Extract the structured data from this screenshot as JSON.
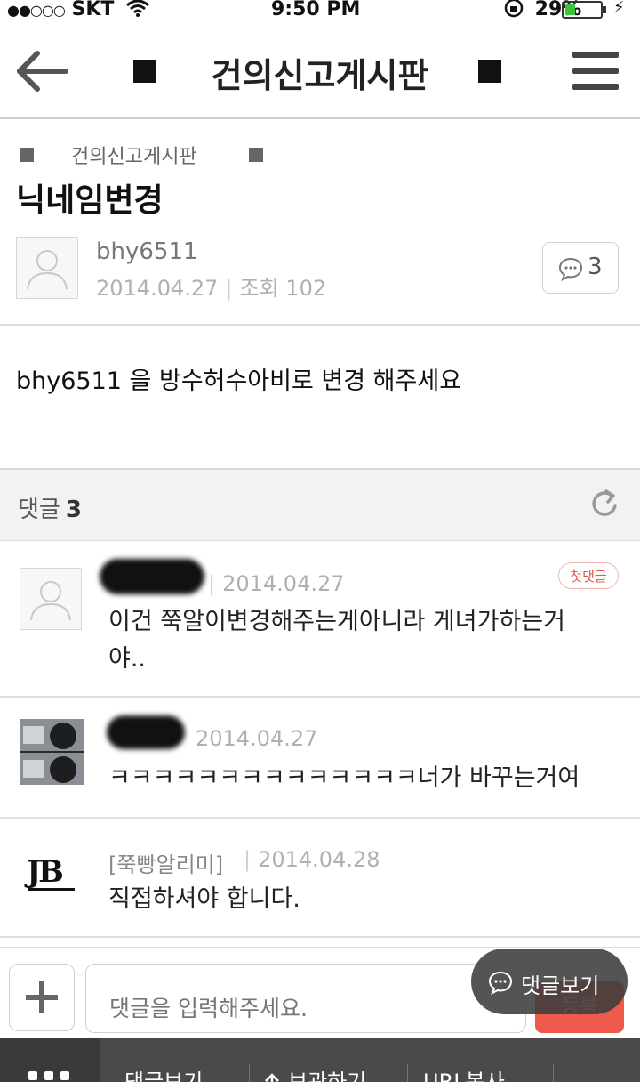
{
  "status_bar": {
    "signal": "●●○○○",
    "carrier": "SKT",
    "time": "9:50 PM",
    "battery_percent": "29%",
    "battery_level": 0.29
  },
  "nav": {
    "title": "건의신고게시판"
  },
  "post": {
    "board": "건의신고게시판",
    "title": "닉네임변경",
    "author": "bhy6511",
    "date": "2014.04.27",
    "views_label": "조회",
    "views": "102",
    "comment_count": "3",
    "content": "bhy6511 을 방수허수아비로 변경 해주세요"
  },
  "comments_header": {
    "label": "댓글",
    "count": "3"
  },
  "comments": [
    {
      "date": "2014.04.27",
      "badge": "첫댓글",
      "text_line1": "이건 쭉알이변경해주는게아니라 게녀가하는거",
      "text_line2": "야.."
    },
    {
      "date": "2014.04.27",
      "text": "ㅋㅋㅋㅋㅋㅋㅋㅋㅋㅋㅋㅋㅋㅋ너가 바꾸는거여"
    },
    {
      "author": "[쭉빵알리미]",
      "date": "2014.04.28",
      "text": "직접하셔야 합니다.",
      "logo_text": "JB"
    }
  ],
  "input_bar": {
    "placeholder": "댓글을 입력해주세요.",
    "submit_label": "등록",
    "float_label": "댓글보기"
  },
  "toolbar": {
    "items": [
      "댓글보기",
      "보관하기",
      "URL복사"
    ]
  },
  "colors": {
    "accent_red": "#ee5b4d",
    "toolbar_bg": "#4a4a4a",
    "battery_green": "#3cc43c"
  }
}
